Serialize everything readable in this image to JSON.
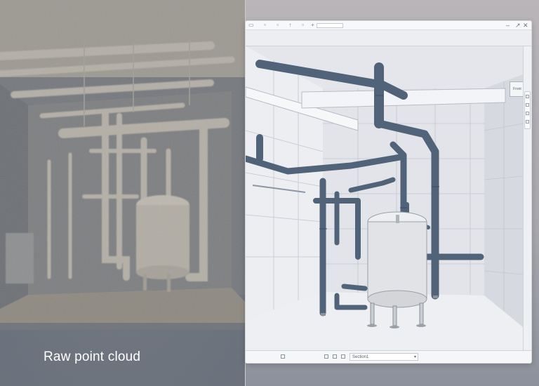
{
  "left_panel": {
    "caption": "Raw point cloud"
  },
  "window": {
    "toolbar_buttons": [
      "window-minimize",
      "expand",
      "close"
    ],
    "view_cube_label": "Front",
    "status_bar": {
      "view_name": "Section1"
    }
  },
  "colors": {
    "pipe": "#516378",
    "pipe_dark": "#3e4d60",
    "tank": "#e2e3e6",
    "wall": "#eceef2",
    "point_cloud_tint": "#8a8780"
  },
  "icons": [
    "minus-icon",
    "expand-icon",
    "close-icon",
    "home-icon",
    "zoom-icon",
    "pan-icon",
    "search-icon"
  ]
}
